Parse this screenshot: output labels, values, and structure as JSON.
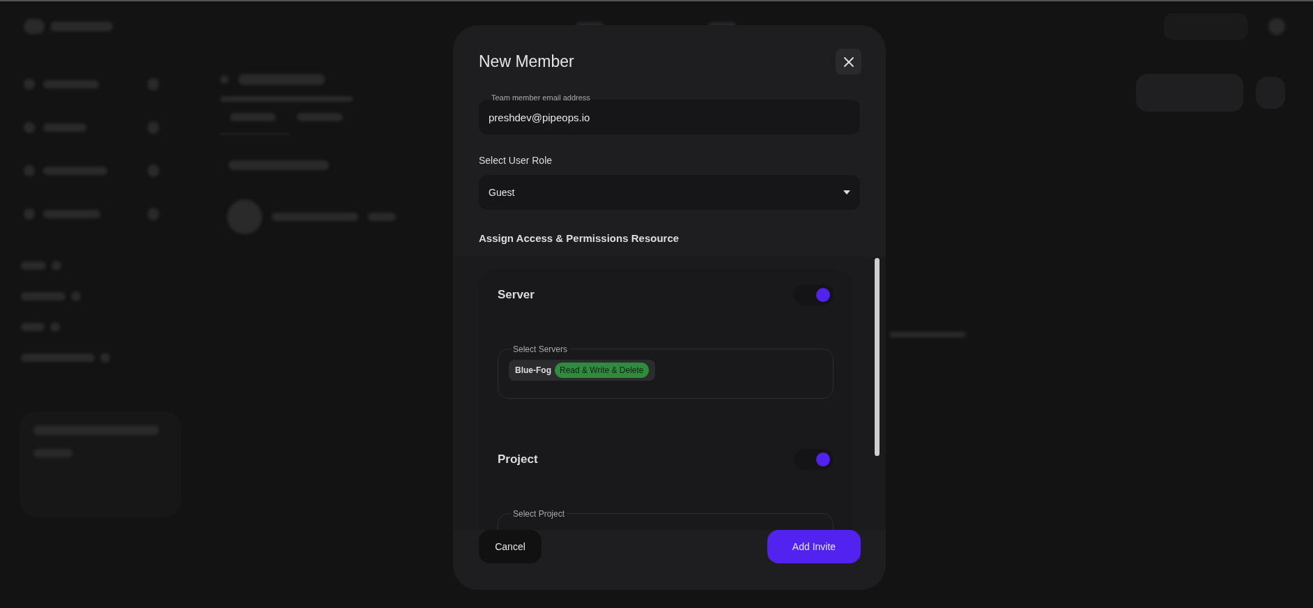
{
  "modal": {
    "title": "New Member",
    "email": {
      "label": "Team member email address",
      "value": "preshdev@pipeops.io"
    },
    "role": {
      "label": "Select User Role",
      "value": "Guest"
    },
    "permissions": {
      "title": "Assign Access & Permissions Resource",
      "resources": [
        {
          "name": "Server",
          "on": true,
          "select_label": "Select Servers",
          "chips": [
            {
              "name": "Blue-Fog",
              "permission": "Read & Write & Delete"
            }
          ]
        },
        {
          "name": "Project",
          "on": true,
          "select_label": "Select Project"
        }
      ]
    },
    "buttons": {
      "cancel": "Cancel",
      "submit": "Add Invite"
    }
  }
}
